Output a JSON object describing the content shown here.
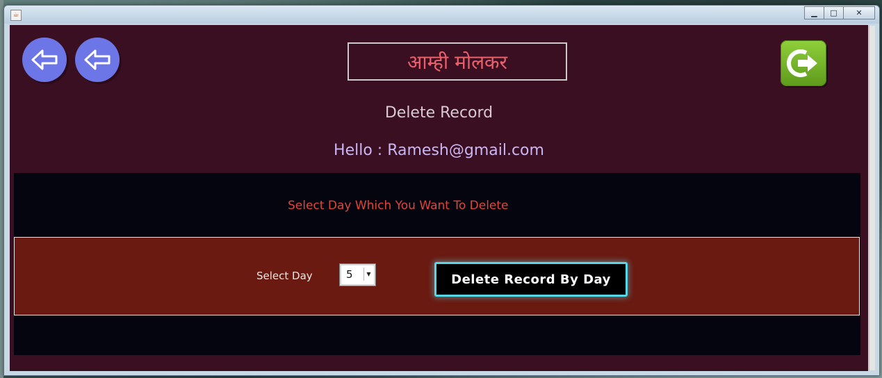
{
  "window": {
    "title": "",
    "controls": {
      "minimize": "▁",
      "maximize": "□",
      "close": "✕"
    }
  },
  "header": {
    "brand_title": "आम्ही मोलकर",
    "page_heading": "Delete Record",
    "greeting": "Hello : Ramesh@gmail.com"
  },
  "panel": {
    "prompt": "Select Day Which You Want To Delete",
    "select_label": "Select Day",
    "selected_day": "5",
    "action_label": "Delete Record By Day"
  },
  "icons": {
    "back_1": "arrow-left-icon",
    "back_2": "arrow-left-icon",
    "logout": "logout-icon"
  },
  "colors": {
    "app_background": "#3a0f22",
    "brand_title": "#e8606a",
    "prompt": "#e0453a",
    "form_panel": "#6a1a10",
    "button_glow": "#57d6e6",
    "logout_green": "#7bbf2c",
    "back_button": "#6d76e6"
  }
}
